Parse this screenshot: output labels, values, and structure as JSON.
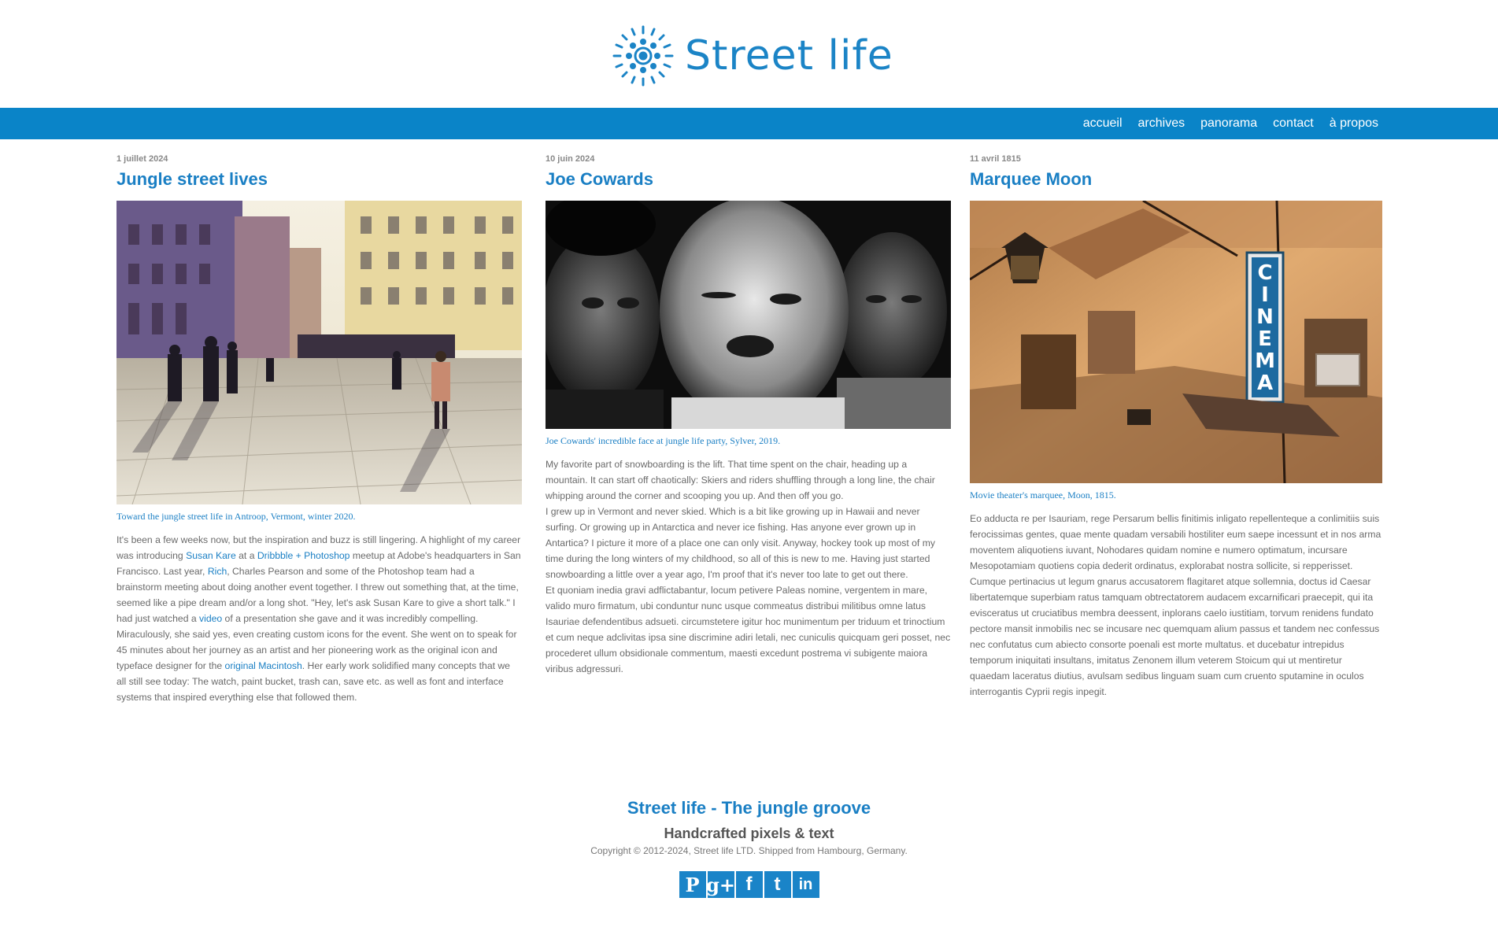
{
  "site": {
    "title": "Street life",
    "brand_color": "#1a7fc4",
    "nav_color": "#0a84c8"
  },
  "nav": {
    "items": [
      "accueil",
      "archives",
      "panorama",
      "contact",
      "à propos"
    ]
  },
  "posts": [
    {
      "date": "1 juillet 2024",
      "title": "Jungle street lives",
      "caption": "Toward the jungle street life in Antroop, Vermont, winter 2020.",
      "p1": {
        "t1": "It's been a few weeks now, but the inspiration and buzz is still lingering. A highlight of my career was introducing ",
        "l1": "Susan Kare",
        "t2": " at a ",
        "l2": "Dribbble + Photoshop",
        "t3": " meetup at Adobe's headquarters in San Francisco. Last year, ",
        "l3": "Rich",
        "t4": ", Charles Pearson and some of the Photoshop team had a brainstorm meeting about doing another event together. I threw out something that, at the time, seemed like a pipe dream and/or a long shot. \"Hey, let's ask Susan Kare to give a short talk.\" I had just watched a ",
        "l4": "video",
        "t5": " of a presentation she gave and it was incredibly compelling."
      },
      "p2": {
        "t1": "Miraculously, she said yes, even creating custom icons for the event. She went on to speak for 45 minutes about her journey as an artist and her pioneering work as the original icon and typeface designer for the ",
        "l1": "original Macintosh",
        "t2": ". Her early work solidified many concepts that we all still see today: The watch, paint bucket, trash can, save etc. as well as font and interface systems that inspired everything else that followed them."
      }
    },
    {
      "date": "10 juin 2024",
      "title": "Joe Cowards",
      "caption": "Joe Cowards' incredible face at jungle life party, Sylver, 2019.",
      "p1": "My favorite part of snowboarding is the lift. That time spent on the chair, heading up a mountain. It can start off chaotically: Skiers and riders shuffling through a long line, the chair whipping around the corner and scooping you up. And then off you go.",
      "p2": "I grew up in Vermont and never skied. Which is a bit like growing up in Hawaii and never surfing. Or growing up in Antarctica and never ice fishing. Has anyone ever grown up in Antartica? I picture it more of a place one can only visit. Anyway, hockey took up most of my time during the long winters of my childhood, so all of this is new to me. Having just started snowboarding a little over a year ago, I'm proof that it's never too late to get out there.",
      "p3": "Et quoniam inedia gravi adflictabantur, locum petivere Paleas nomine, vergentem in mare, valido muro firmatum, ubi conduntur nunc usque commeatus distribui militibus omne latus Isauriae defendentibus adsueti. circumstetere igitur hoc munimentum per triduum et trinoctium et cum neque adclivitas ipsa sine discrimine adiri letali, nec cuniculis quicquam geri posset, nec procederet ullum obsidionale commentum, maesti excedunt postrema vi subigente maiora viribus adgressuri."
    },
    {
      "date": "11 avril 1815",
      "title": "Marquee Moon",
      "caption": "Movie theater's marquee, Moon, 1815.",
      "sign": "CINEMA",
      "p1": "Eo adducta re per Isauriam, rege Persarum bellis finitimis inligato repellenteque a conlimitiis suis ferocissimas gentes, quae mente quadam versabili hostiliter eum saepe incessunt et in nos arma moventem aliquotiens iuvant, Nohodares quidam nomine e numero optimatum, incursare Mesopotamiam quotiens copia dederit ordinatus, explorabat nostra sollicite, si repperisset.",
      "p2": "Cumque pertinacius ut legum gnarus accusatorem flagitaret atque sollemnia, doctus id Caesar libertatemque superbiam ratus tamquam obtrectatorem audacem excarnificari praecepit, qui ita evisceratus ut cruciatibus membra deessent, inplorans caelo iustitiam, torvum renidens fundato pectore mansit inmobilis nec se incusare nec quemquam alium passus et tandem nec confessus nec confutatus cum abiecto consorte poenali est morte multatus. et ducebatur intrepidus temporum iniquitati insultans, imitatus Zenonem illum veterem Stoicum qui ut mentiretur quaedam laceratus diutius, avulsam sedibus linguam suam cum cruento sputamine in oculos interrogantis Cyprii regis inpegit."
    }
  ],
  "footer": {
    "title": "Street life - The jungle groove",
    "subtitle": "Handcrafted pixels & text",
    "copyright": "Copyright © 2012-2024, Street life LTD. Shipped from Hambourg, Germany.",
    "social": [
      {
        "name": "pinterest-icon",
        "glyph": "P"
      },
      {
        "name": "google-plus-icon",
        "glyph": "g+"
      },
      {
        "name": "facebook-icon",
        "glyph": "f"
      },
      {
        "name": "tumblr-icon",
        "glyph": "t"
      },
      {
        "name": "linkedin-icon",
        "glyph": "in"
      }
    ]
  }
}
